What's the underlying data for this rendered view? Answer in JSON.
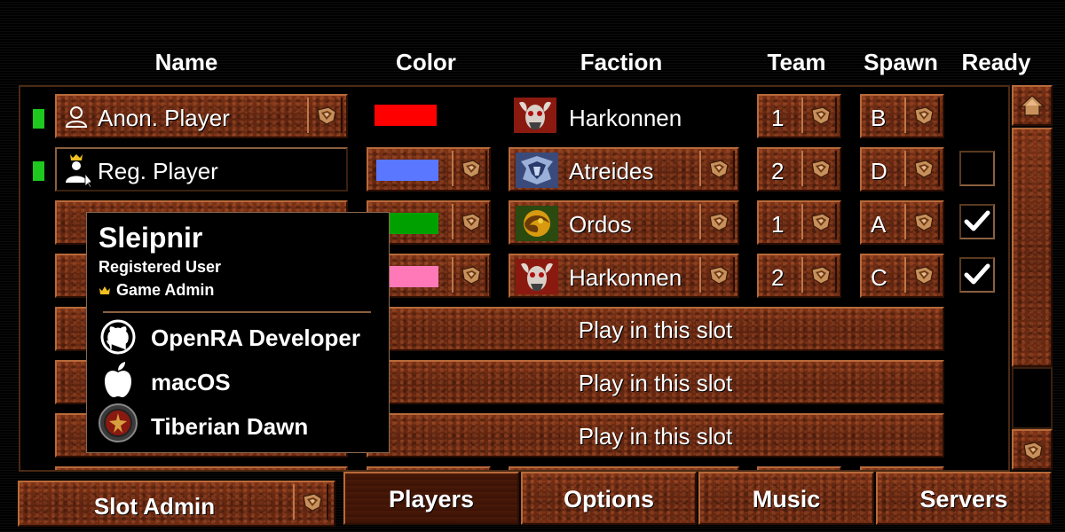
{
  "headers": {
    "name": "Name",
    "color": "Color",
    "faction": "Faction",
    "team": "Team",
    "spawn": "Spawn",
    "ready": "Ready"
  },
  "players": [
    {
      "name": "Anon. Player",
      "account": "anonymous",
      "color": "#ff0000",
      "faction": "Harkonnen",
      "team": "1",
      "spawn": "B",
      "ready": null
    },
    {
      "name": "Reg. Player",
      "account": "registered",
      "color": "#5a78ff",
      "faction": "Atreides",
      "team": "2",
      "spawn": "D",
      "ready": false
    },
    {
      "color": "#00a000",
      "faction": "Ordos",
      "team": "1",
      "spawn": "A",
      "ready": true
    },
    {
      "color": "#ff78b8",
      "faction": "Harkonnen",
      "team": "2",
      "spawn": "C",
      "ready": true
    }
  ],
  "open_slots": [
    {
      "label": "Play in this slot"
    },
    {
      "label": "Play in this slot"
    },
    {
      "label": "Play in this slot"
    }
  ],
  "tooltip": {
    "name": "Sleipnir",
    "role": "Registered User",
    "admin": "Game Admin",
    "badges": [
      {
        "icon": "github-icon",
        "label": "OpenRA Developer"
      },
      {
        "icon": "apple-icon",
        "label": "macOS"
      },
      {
        "icon": "tiberian-dawn-icon",
        "label": "Tiberian Dawn"
      }
    ]
  },
  "bottom": {
    "slot_admin": "Slot Admin"
  },
  "tabs": [
    {
      "label": "Players"
    },
    {
      "label": "Options"
    },
    {
      "label": "Music"
    },
    {
      "label": "Servers"
    }
  ],
  "colors": {
    "status_green": "#1ec81e",
    "leather": "#6b2a12"
  }
}
